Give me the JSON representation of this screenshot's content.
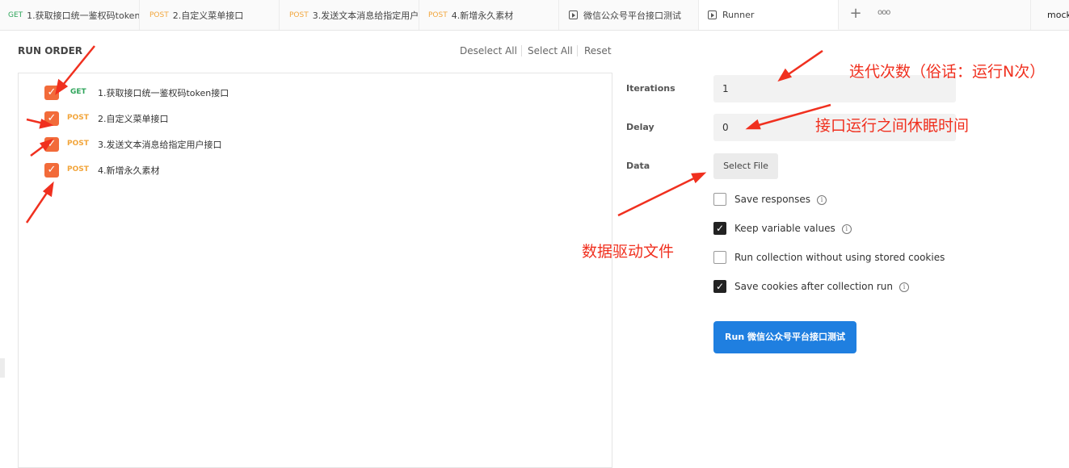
{
  "tabs": [
    {
      "method": "GET",
      "name": "1.获取接口统一鉴权码token"
    },
    {
      "method": "POST",
      "name": "2.自定义菜单接口"
    },
    {
      "method": "POST",
      "name": "3.发送文本消息给指定用户"
    },
    {
      "method": "POST",
      "name": "4.新增永久素材"
    },
    {
      "method": "",
      "name": "微信公众号平台接口测试"
    },
    {
      "method": "",
      "name": "Runner"
    }
  ],
  "tabbar": {
    "plus": "+",
    "more": "ooo",
    "env": "mock"
  },
  "run_order": {
    "title": "RUN ORDER",
    "deselect_all": "Deselect All",
    "select_all": "Select All",
    "reset": "Reset",
    "requests": [
      {
        "method": "GET",
        "name": "1.获取接口统一鉴权码token接口",
        "checked": true
      },
      {
        "method": "POST",
        "name": "2.自定义菜单接口",
        "checked": true
      },
      {
        "method": "POST",
        "name": "3.发送文本消息给指定用户接口",
        "checked": true
      },
      {
        "method": "POST",
        "name": "4.新增永久素材",
        "checked": true
      }
    ]
  },
  "settings": {
    "iterations_label": "Iterations",
    "iterations_value": "1",
    "delay_label": "Delay",
    "delay_value": "0",
    "data_label": "Data",
    "select_file": "Select File",
    "options": [
      {
        "label": "Save responses",
        "checked": false,
        "info": true
      },
      {
        "label": "Keep variable values",
        "checked": true,
        "info": true
      },
      {
        "label": "Run collection without using stored cookies",
        "checked": false,
        "info": false
      },
      {
        "label": "Save cookies after collection run",
        "checked": true,
        "info": true
      }
    ],
    "run_button": "Run 微信公众号平台接口测试"
  },
  "annotations": {
    "iterations_note": "迭代次数（俗话：运行N次）",
    "delay_note": "接口运行之间休眠时间",
    "data_note": "数据驱动文件"
  },
  "colors": {
    "accent_orange": "#f26b3a",
    "get_green": "#2fa55b",
    "post_orange": "#f2a53b",
    "run_blue": "#1f7fe0",
    "annotation_red": "#f0301f"
  }
}
